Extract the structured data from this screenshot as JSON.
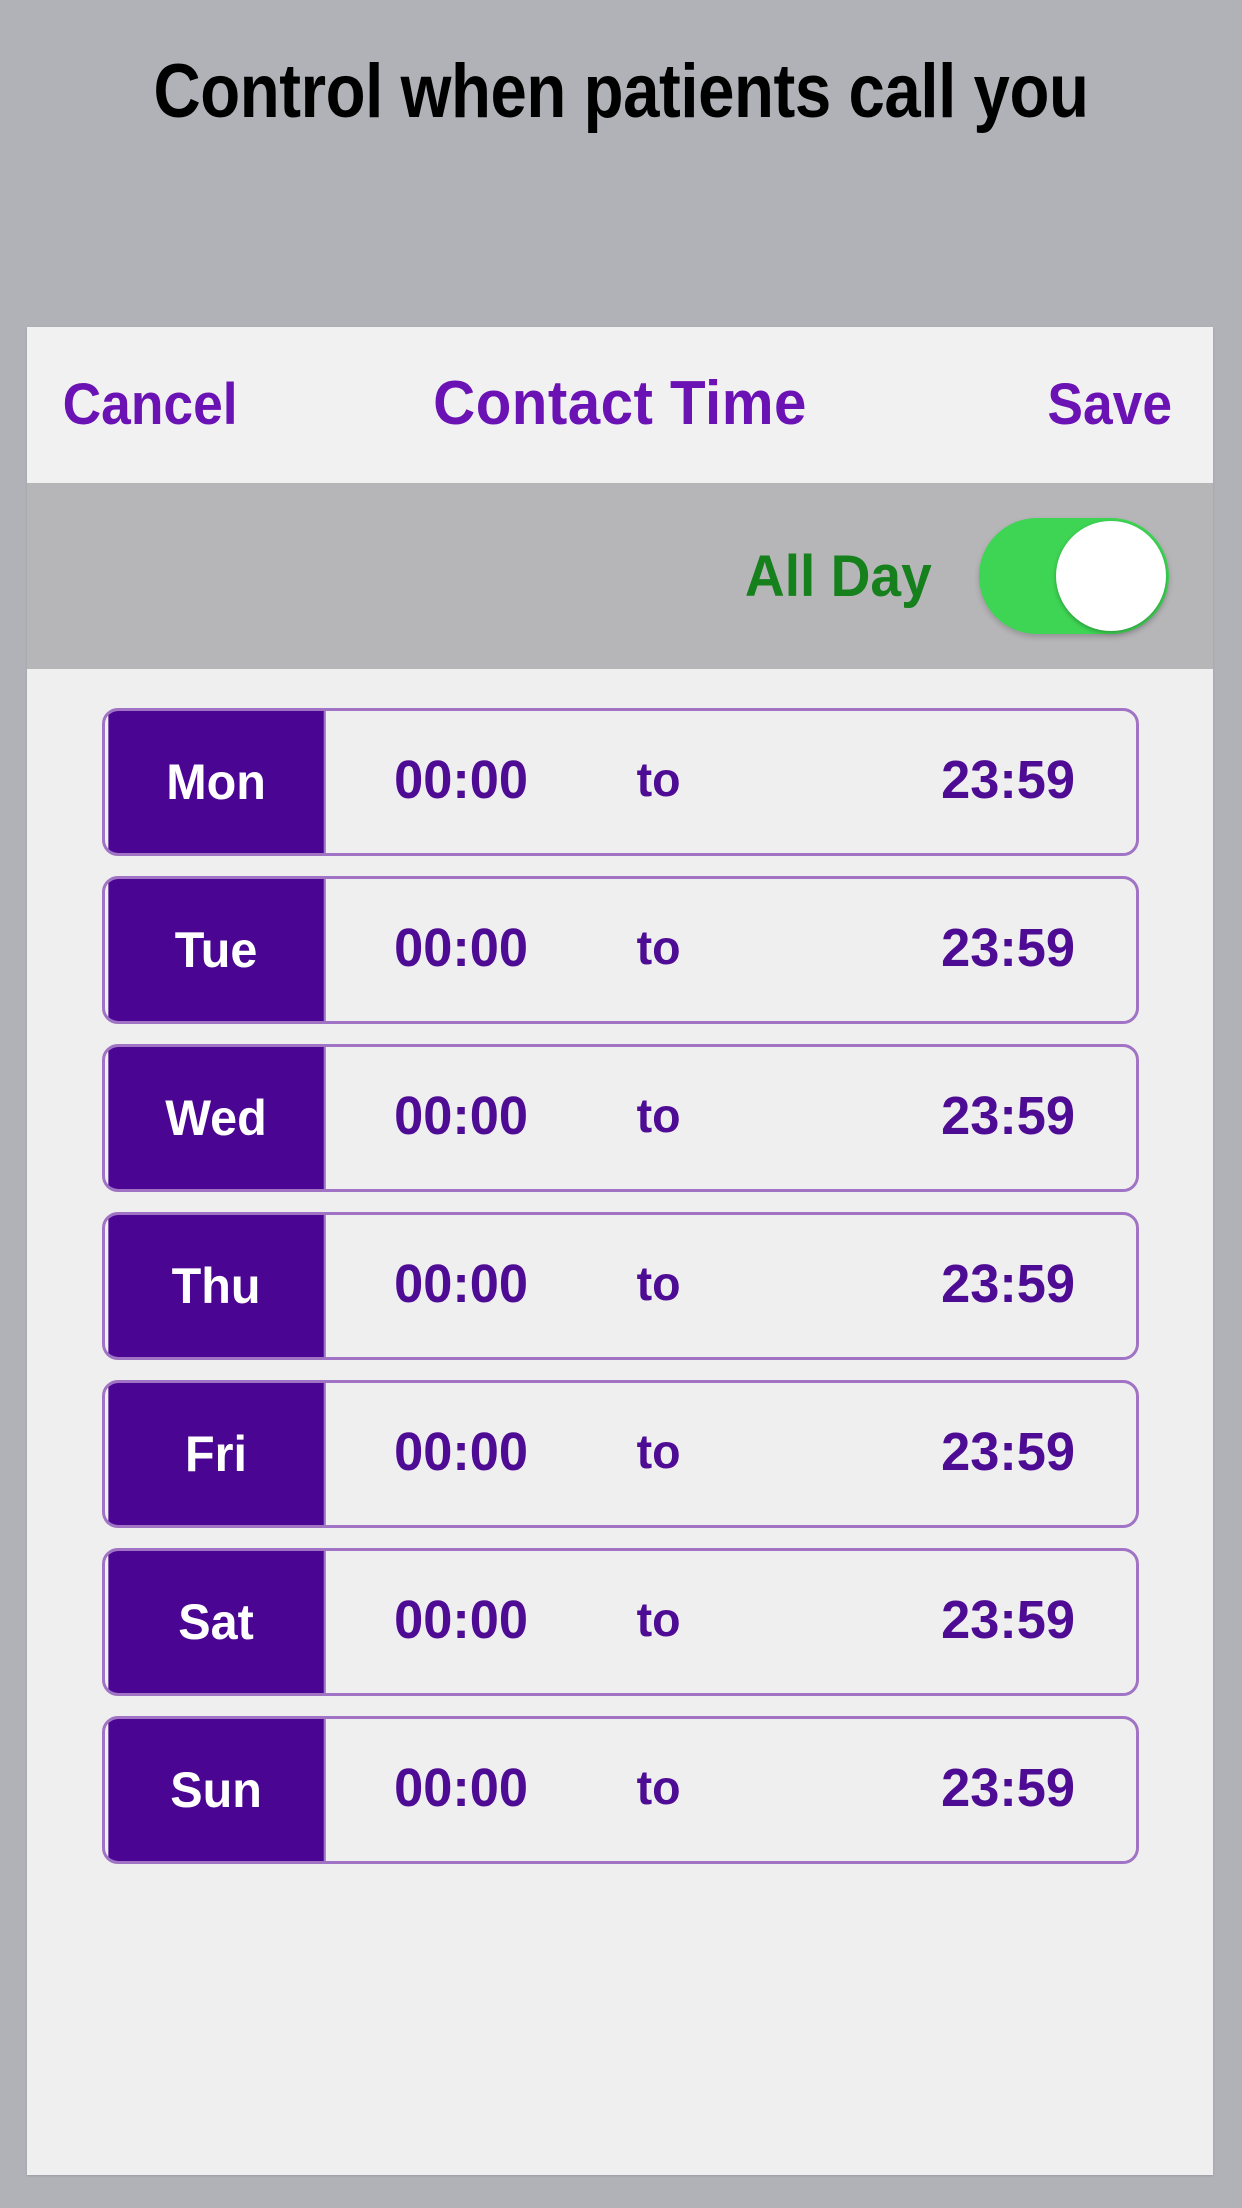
{
  "page": {
    "heading": "Control when patients call you",
    "background_color": "#b0b2b8"
  },
  "colors": {
    "brand_purple": "#6a12b3",
    "badge_purple": "#4b0593",
    "time_purple": "#4e0b93",
    "row_border": "#a073c4",
    "toggle_on_green": "#3ed554",
    "allday_label_green": "#16801d",
    "card_background": "#efeff0",
    "navbar_background": "#f2f1f2",
    "allday_row_background": "#b6b6b9"
  },
  "navbar": {
    "cancel_label": "Cancel",
    "title": "Contact Time",
    "save_label": "Save"
  },
  "allday": {
    "label": "All Day",
    "toggle_state": "on"
  },
  "schedule": {
    "separator_label": "to",
    "rows": [
      {
        "day": "Mon",
        "start": "00:00",
        "end": "23:59"
      },
      {
        "day": "Tue",
        "start": "00:00",
        "end": "23:59"
      },
      {
        "day": "Wed",
        "start": "00:00",
        "end": "23:59"
      },
      {
        "day": "Thu",
        "start": "00:00",
        "end": "23:59"
      },
      {
        "day": "Fri",
        "start": "00:00",
        "end": "23:59"
      },
      {
        "day": "Sat",
        "start": "00:00",
        "end": "23:59"
      },
      {
        "day": "Sun",
        "start": "00:00",
        "end": "23:59"
      }
    ]
  }
}
